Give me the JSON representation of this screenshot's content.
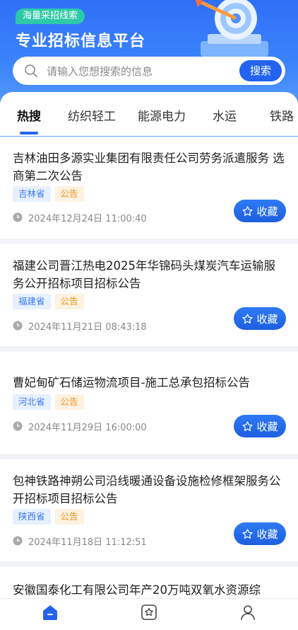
{
  "header": {
    "tag": "海量采招线索",
    "title": "专业招标信息平台"
  },
  "search": {
    "placeholder": "请输入您想搜索的信息",
    "button": "搜索"
  },
  "tabs": [
    {
      "label": "热搜",
      "active": true
    },
    {
      "label": "纺织轻工",
      "active": false
    },
    {
      "label": "能源电力",
      "active": false
    },
    {
      "label": "水运",
      "active": false
    },
    {
      "label": "铁路",
      "active": false
    }
  ],
  "list": [
    {
      "title": "吉林油田多源实业集团有限责任公司劳务派遣服务 选商第二次公告",
      "province": "吉林省",
      "type": "公告",
      "time": "2024年12月24日 11:00:40",
      "fav": "收藏"
    },
    {
      "title": "福建公司晋江热电2025年华锦码头煤炭汽车运输服务公开招标项目招标公告",
      "province": "福建省",
      "type": "公告",
      "time": "2024年11月21日 08:43:18",
      "fav": "收藏"
    },
    {
      "title": "曹妃甸矿石储运物流项目-施工总承包招标公告",
      "province": "河北省",
      "type": "公告",
      "time": "2024年11月29日 16:00:00",
      "fav": "收藏"
    },
    {
      "title": "包神铁路神朔公司沿线暖通设备设施检修框架服务公开招标项目招标公告",
      "province": "陕西省",
      "type": "公告",
      "time": "2024年11月18日 11:12:51",
      "fav": "收藏"
    },
    {
      "title": "安徽国泰化工有限公司年产20万吨双氧水资源综"
    }
  ],
  "colors": {
    "brand": "#2463f0",
    "tag_green": "#2ec9a8",
    "province_text": "#3b7bf0",
    "type_text": "#f0921c"
  },
  "bottom_nav": [
    {
      "icon": "home-icon",
      "active": true
    },
    {
      "icon": "star-box-icon",
      "active": false
    },
    {
      "icon": "user-icon",
      "active": false
    }
  ]
}
